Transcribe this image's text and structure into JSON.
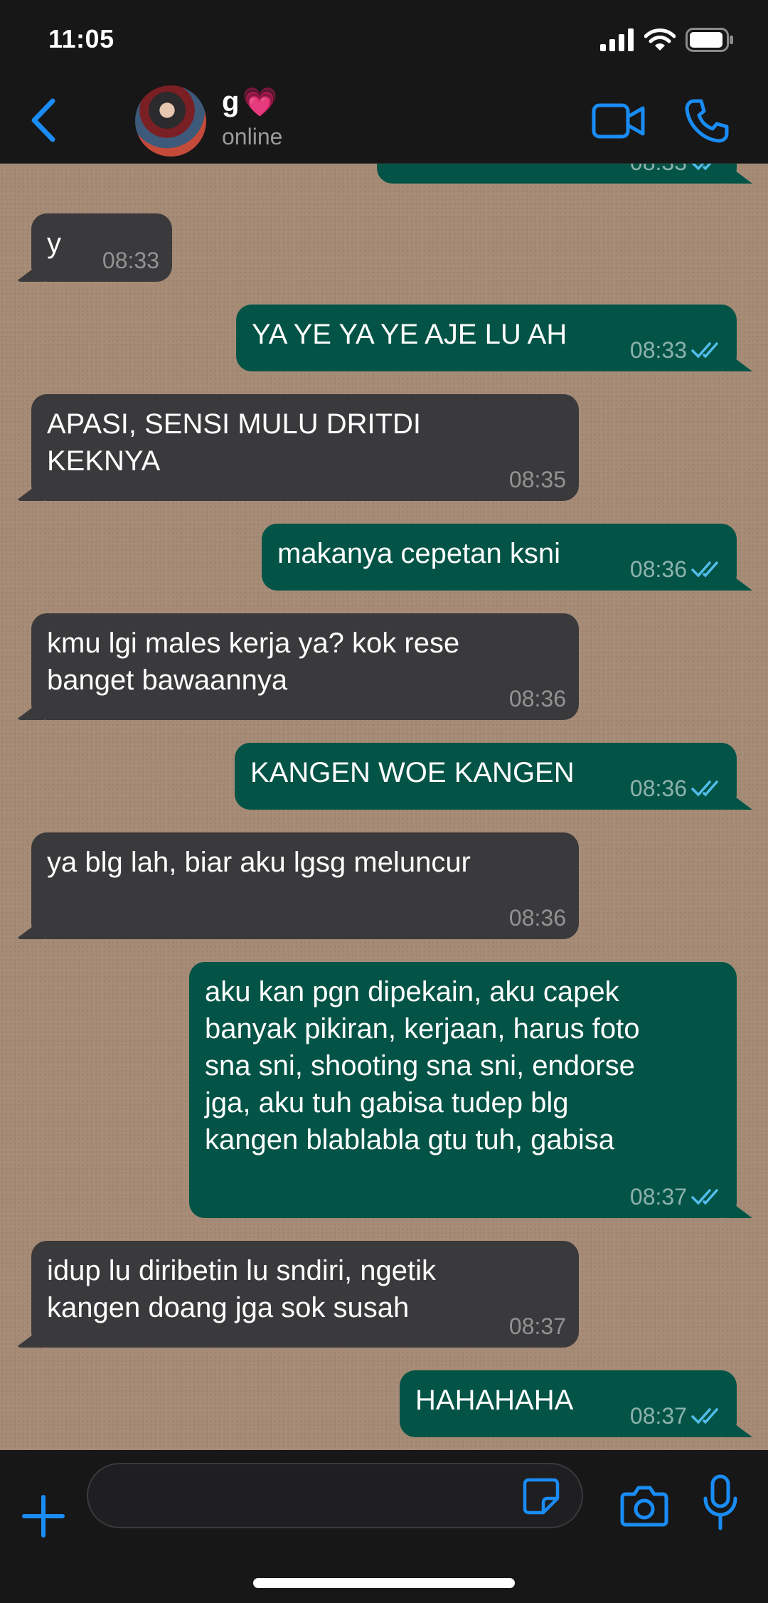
{
  "status_bar": {
    "time": "11:05"
  },
  "header": {
    "contact_name": "g",
    "name_emoji": "💗",
    "status": "online"
  },
  "messages": [
    {
      "dir": "out",
      "text": "",
      "time": "08:33"
    },
    {
      "dir": "in",
      "text": "y",
      "time": "08:33"
    },
    {
      "dir": "out",
      "text": "YA YE YA YE AJE LU AH",
      "time": "08:33"
    },
    {
      "dir": "in",
      "line1": "APASI, SENSI MULU DRITDI",
      "line2": "KEKNYA",
      "time": "08:35"
    },
    {
      "dir": "out",
      "text": "makanya cepetan ksni",
      "time": "08:36"
    },
    {
      "dir": "in",
      "line1": "kmu lgi males kerja ya? kok rese",
      "line2": "banget bawaannya",
      "time": "08:36"
    },
    {
      "dir": "out",
      "text": "KANGEN WOE KANGEN",
      "time": "08:36"
    },
    {
      "dir": "in",
      "text": "ya blg lah, biar aku lgsg meluncur",
      "time": "08:36"
    },
    {
      "dir": "out",
      "lines": [
        "aku kan pgn dipekain, aku capek",
        "banyak pikiran, kerjaan, harus foto",
        "sna sni, shooting sna sni, endorse",
        "jga, aku tuh gabisa tudep blg",
        "kangen blablabla gtu tuh, gabisa"
      ],
      "time": "08:37"
    },
    {
      "dir": "in",
      "line1": "idup lu diribetin lu sndiri, ngetik",
      "line2": "kangen doang jga sok susah",
      "time": "08:37"
    },
    {
      "dir": "out",
      "text": "HAHAHAHA",
      "time": "08:37"
    }
  ],
  "colors": {
    "incoming": "#3a393b",
    "outgoing": "#035446",
    "accent": "#1a8cf5",
    "read_ticks": "#53bdeb"
  }
}
